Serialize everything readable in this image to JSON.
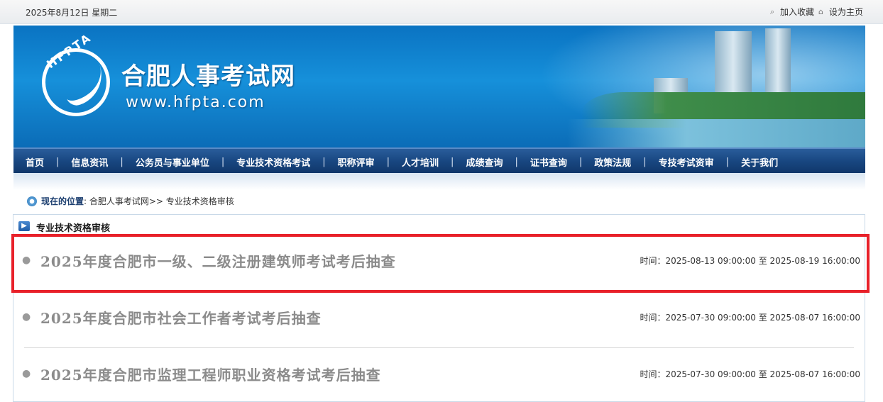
{
  "topbar": {
    "date": "2025年8月12日 星期二",
    "favorite_label": "加入收藏",
    "homepage_label": "设为主页"
  },
  "banner": {
    "logo_text": "HFPTA",
    "title": "合肥人事考试网",
    "url": "www.hfpta.com"
  },
  "nav": {
    "items": [
      "首页",
      "信息资讯",
      "公务员与事业单位",
      "专业技术资格考试",
      "职称评审",
      "人才培训",
      "成绩查询",
      "证书查询",
      "政策法规",
      "专技考试资审",
      "关于我们"
    ],
    "separator": "|"
  },
  "breadcrumb": {
    "label": "现在的位置",
    "path": ": 合肥人事考试网>> 专业技术资格审核"
  },
  "panel": {
    "title": "专业技术资格审核",
    "items": [
      {
        "title": "2025年度合肥市一级、二级注册建筑师考试考后抽查",
        "time": "时间：2025-08-13 09:00:00 至 2025-08-19 16:00:00"
      },
      {
        "title": "2025年度合肥市社会工作者考试考后抽查",
        "time": "时间：2025-07-30 09:00:00 至 2025-08-07 16:00:00"
      },
      {
        "title": "2025年度合肥市监理工程师职业资格考试考后抽查",
        "time": "时间：2025-07-30 09:00:00 至 2025-08-07 16:00:00"
      }
    ]
  },
  "colors": {
    "highlight": "#e8212a",
    "nav_bg": "#184680",
    "banner_bg": "#1690da"
  }
}
